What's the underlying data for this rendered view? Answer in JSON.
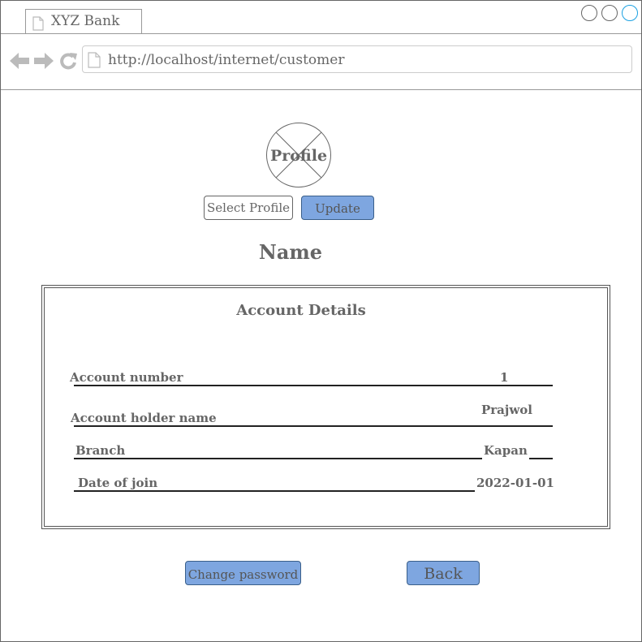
{
  "browser": {
    "tab_title": "XYZ Bank",
    "url": "http://localhost/internet/customer"
  },
  "profile": {
    "avatar_label": "Profile",
    "select_button": "Select Profile",
    "update_button": "Update"
  },
  "name_heading": "Name",
  "account_details": {
    "title": "Account Details",
    "fields": [
      {
        "label": "Account number",
        "value": "1"
      },
      {
        "label": "Account holder name",
        "value": "Prajwol"
      },
      {
        "label": "Branch",
        "value": "Kapan"
      },
      {
        "label": "Date of join",
        "value": "2022-01-01"
      }
    ]
  },
  "actions": {
    "change_password": "Change password",
    "back": "Back"
  },
  "colors": {
    "button_blue": "#7ea6e0",
    "text_gray": "#666666",
    "active_window_button": "#1ba1e2"
  }
}
